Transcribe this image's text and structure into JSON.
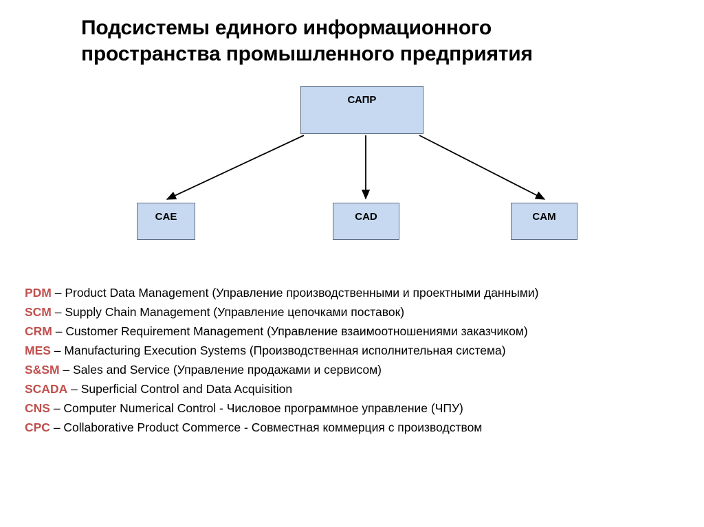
{
  "title": {
    "line1": "Подсистемы единого информационного",
    "line2": "пространства промышленного предприятия"
  },
  "diagram": {
    "type": "hierarchy",
    "root": {
      "id": "sapr",
      "label": "САПР"
    },
    "children": [
      {
        "id": "cae",
        "label": "CAE"
      },
      {
        "id": "cad",
        "label": "CAD"
      },
      {
        "id": "cam",
        "label": "CAM"
      }
    ],
    "edges": [
      {
        "from": "sapr",
        "to": "cae",
        "arrow": "end"
      },
      {
        "from": "sapr",
        "to": "cad",
        "arrow": "end"
      },
      {
        "from": "sapr",
        "to": "cam",
        "arrow": "end"
      }
    ],
    "colors": {
      "box_fill": "#C6D9F0",
      "box_border": "#5A6B80",
      "arrow": "#000000"
    }
  },
  "legend": {
    "accent_color": "#C0504D",
    "entries": [
      {
        "acronym": "PDM",
        "text": " – Product  Data  Management  (Управление  производственными  и  проектными данными)"
      },
      {
        "acronym": "SCM",
        "text": " – Supply Chain Management  (Управление цепочками поставок)"
      },
      {
        "acronym": "CRM",
        "text": " –  Customer  Requirement  Management  (Управление  взаимоотношениями заказчиком)"
      },
      {
        "acronym": "MES",
        "text": " – Manufacturing Execution Systems (Производственная исполнительная система)"
      },
      {
        "acronym": "S&SM",
        "text": " – Sales and Service (Управление продажами и сервисом)"
      },
      {
        "acronym": "SCADA",
        "text": " – Superficial Control and Data  Acquisition"
      },
      {
        "acronym": "CNS",
        "text": " – Computer Numerical  Control - Числовое программное управление (ЧПУ)"
      },
      {
        "acronym": "CPC",
        "text": " – Collaborative  Product Commerce - Совместная коммерция с производством"
      }
    ]
  }
}
